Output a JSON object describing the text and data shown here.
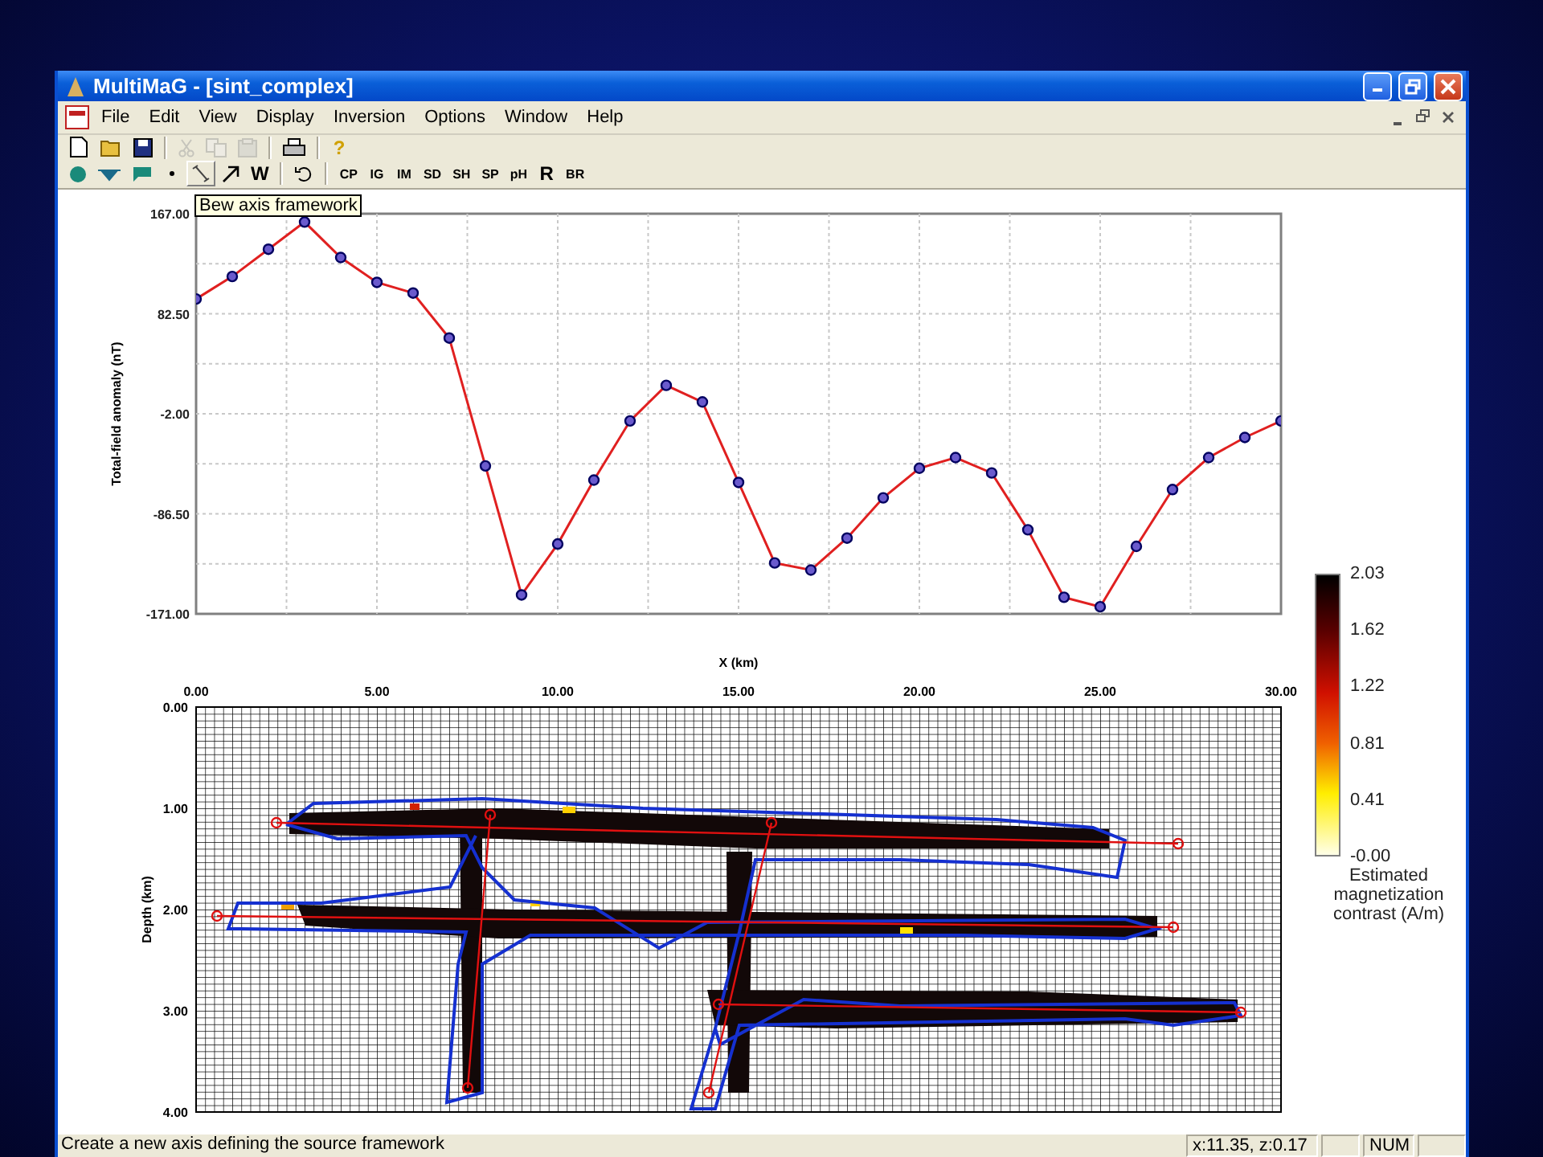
{
  "window": {
    "title": "MultiMaG - [sint_complex]"
  },
  "menu": [
    "File",
    "Edit",
    "View",
    "Display",
    "Inversion",
    "Options",
    "Window",
    "Help"
  ],
  "toolbar_1": [
    [
      {
        "kind": "new",
        "disabled": false
      },
      {
        "kind": "open",
        "disabled": false
      },
      {
        "kind": "save",
        "disabled": false
      }
    ],
    [
      {
        "kind": "cut",
        "disabled": true
      },
      {
        "kind": "copy",
        "disabled": true
      },
      {
        "kind": "paste",
        "disabled": true
      }
    ],
    [
      {
        "kind": "print",
        "disabled": false
      }
    ],
    [
      {
        "kind": "help",
        "label": "?",
        "disabled": false
      }
    ]
  ],
  "toolbar_2": [
    [
      {
        "kind": "circle",
        "hovered": false
      },
      {
        "kind": "triangle",
        "hovered": false
      },
      {
        "kind": "flag",
        "hovered": false
      },
      {
        "kind": "dot",
        "hovered": false
      },
      {
        "kind": "line",
        "hovered": true
      },
      {
        "kind": "arrow",
        "hovered": false
      },
      {
        "kind": "text-big",
        "label": "W",
        "hovered": false
      }
    ],
    [
      {
        "kind": "undo",
        "hovered": false
      }
    ],
    [
      {
        "kind": "text-small",
        "label": "CP",
        "hovered": false
      },
      {
        "kind": "text-small",
        "label": "IG",
        "hovered": false
      },
      {
        "kind": "text-small",
        "label": "IM",
        "hovered": false
      },
      {
        "kind": "text-small",
        "label": "SD",
        "hovered": false
      },
      {
        "kind": "text-small",
        "label": "SH",
        "hovered": false
      },
      {
        "kind": "text-small",
        "label": "SP",
        "hovered": false
      },
      {
        "kind": "text-small",
        "label": "pH",
        "hovered": false
      },
      {
        "kind": "text-big",
        "label": "R",
        "hovered": false
      },
      {
        "kind": "text-small",
        "label": "BR",
        "hovered": false
      }
    ]
  ],
  "tooltip": "Bew axis framework",
  "anomaly_chart": {
    "chart_data": {
      "type": "line",
      "grid": true,
      "ylabel": "Total-field anomaly (nT)",
      "xlabel": "X (km)",
      "ylim": [
        -171,
        167
      ],
      "yticks": [
        {
          "value": 167,
          "label": "167.00"
        },
        {
          "value": 82.5,
          "label": "82.50"
        },
        {
          "value": -2,
          "label": "-2.00"
        },
        {
          "value": -86.5,
          "label": "-86.50"
        },
        {
          "value": -171,
          "label": "-171.00"
        }
      ],
      "categories": [
        null,
        null,
        null,
        null,
        null,
        null,
        null,
        null,
        null,
        null,
        null,
        null,
        null,
        null,
        null,
        null,
        null,
        null,
        null,
        null,
        null,
        null,
        null,
        null,
        null,
        null,
        null,
        null,
        null,
        null,
        null
      ],
      "series": [
        {
          "color": "#e02020",
          "marker": "o",
          "values": [
            95,
            114,
            137,
            160,
            130,
            109,
            100,
            62,
            -46,
            -155,
            -112,
            -58,
            -8,
            22,
            8,
            -60,
            -128,
            -134,
            -107,
            -73,
            -48,
            -39,
            -52,
            -100,
            -157,
            -165,
            -114,
            -66,
            -39,
            -22,
            -8
          ]
        }
      ]
    }
  },
  "section": {
    "ylabel": "Depth (km)",
    "xticks": [
      "0.00",
      "5.00",
      "10.00",
      "15.00",
      "20.00",
      "25.00",
      "30.00"
    ],
    "yticks": [
      "0.00",
      "1.00",
      "2.00",
      "3.00",
      "4.00"
    ]
  },
  "colorbar": {
    "labels": [
      "2.03",
      "1.62",
      "1.22",
      "0.81",
      "0.41",
      "-0.00"
    ],
    "title": "Estimated magnetization contrast (A/m)"
  },
  "status_bar": {
    "message": "Create a new axis defining the source framework",
    "position": "x:11.35, z:0.17",
    "indicator": "NUM"
  }
}
